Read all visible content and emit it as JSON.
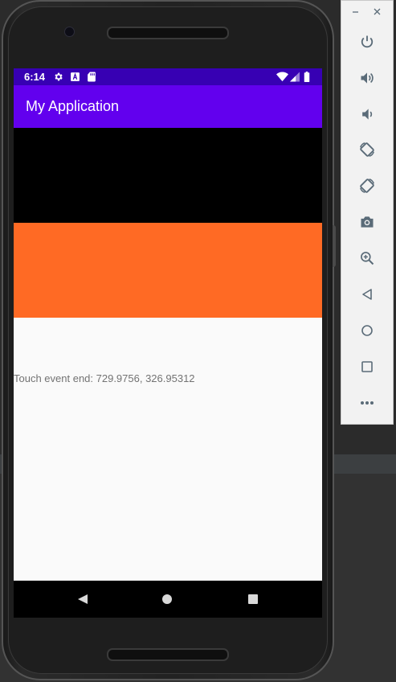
{
  "status_bar": {
    "time": "6:14",
    "left_icons": [
      "gear-icon",
      "font-a-icon",
      "sd-card-icon"
    ],
    "right_icons": [
      "wifi-icon",
      "signal-icon",
      "battery-icon"
    ]
  },
  "app_bar": {
    "title": "My Application"
  },
  "content": {
    "touch_event_text": "Touch event end: 729.9756, 326.95312"
  },
  "nav_bar": {
    "buttons": [
      "back",
      "home",
      "recents"
    ]
  },
  "emulator_toolbar": {
    "window_controls": [
      "minimize",
      "close"
    ],
    "buttons": [
      "power",
      "volume-up",
      "volume-down",
      "rotate-left",
      "rotate-right",
      "take-screenshot",
      "zoom",
      "back",
      "home",
      "overview",
      "more"
    ]
  },
  "colors": {
    "status_bar": "#3700b3",
    "app_bar": "#6200ee",
    "panel_black": "#000000",
    "panel_orange": "#ff6a24",
    "screen_bg": "#fafafa",
    "text_gray": "#737373",
    "toolbar_icon": "#5a6b78"
  }
}
